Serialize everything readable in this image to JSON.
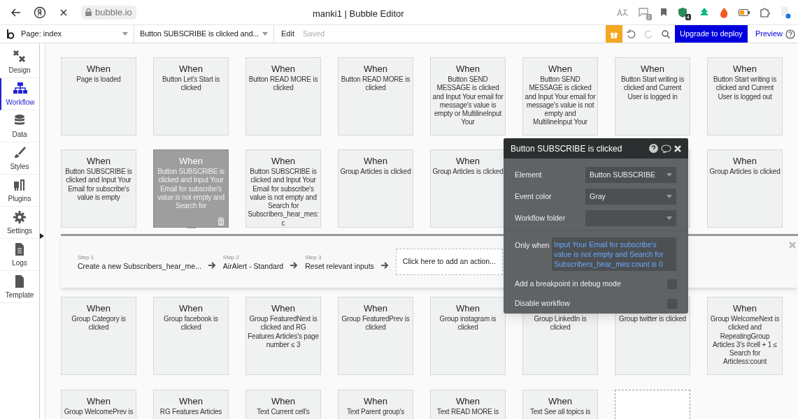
{
  "browser": {
    "url": "bubble.io",
    "title": "manki1 | Bubble Editor",
    "badges": [
      "2",
      "4"
    ]
  },
  "toolbar": {
    "page_selector": "Page: index",
    "workflow_selector": "Button SUBSCRIBE is clicked and...",
    "edit": "Edit",
    "save_status": "Saved",
    "upgrade": "Upgrade to deploy",
    "preview": "Preview"
  },
  "sidebar": {
    "items": [
      {
        "label": "Design",
        "selected": false,
        "kind": "design"
      },
      {
        "label": "Workflow",
        "selected": true,
        "kind": "workflow"
      },
      {
        "label": "Data",
        "selected": false,
        "kind": "data"
      },
      {
        "label": "Styles",
        "selected": false,
        "kind": "styles"
      },
      {
        "label": "Plugins",
        "selected": false,
        "kind": "plugins"
      },
      {
        "label": "Settings",
        "selected": false,
        "kind": "settings"
      },
      {
        "label": "Logs",
        "selected": false,
        "kind": "logs"
      },
      {
        "label": "Template",
        "selected": false,
        "kind": "template"
      }
    ]
  },
  "event_rows_above": [
    {
      "cards": [
        {
          "kind": "event",
          "heading": "When",
          "text": "Page is loaded",
          "selected": false
        },
        {
          "kind": "event",
          "heading": "When",
          "text": "Button Let's Start is clicked",
          "selected": false
        },
        {
          "kind": "event",
          "heading": "When",
          "text": "Button READ MORE is clicked",
          "selected": false
        },
        {
          "kind": "event",
          "heading": "When",
          "text": "Button READ MORE is clicked",
          "selected": false
        },
        {
          "kind": "event",
          "heading": "When",
          "text": "Button SEND MESSAGE is clicked and Input Your email for message's value is empty or MultilineInput Your",
          "selected": false
        },
        {
          "kind": "event",
          "heading": "When",
          "text": "Button SEND MESSAGE is clicked and Input Your email for message's value is not empty and MultilineInput Your",
          "selected": false
        },
        {
          "kind": "event",
          "heading": "When",
          "text": "Button Start writing is clicked and Current User is logged in",
          "selected": false
        },
        {
          "kind": "event",
          "heading": "When",
          "text": "Button Start writing is clicked and Current User is logged out",
          "selected": false
        }
      ]
    },
    {
      "cards": [
        {
          "kind": "event",
          "heading": "When",
          "text": "Button SUBSCRIBE is clicked and Input Your Email for subscribe's value is empty",
          "selected": false
        },
        {
          "kind": "event",
          "heading": "When",
          "text": "Button SUBSCRIBE is clicked and Input Your Email for subscribe's value is not empty and Search for",
          "selected": true
        },
        {
          "kind": "event",
          "heading": "When",
          "text": "Button SUBSCRIBE is clicked and Input Your Email for subscribe's value is not empty and Search for Subscribers_hear_mes:c",
          "selected": false
        },
        {
          "kind": "event",
          "heading": "When",
          "text": "Group Articles is clicked",
          "selected": false
        },
        {
          "kind": "event",
          "heading": "When",
          "text": "Group Articles is clicked",
          "selected": false
        },
        {
          "kind": "covered"
        },
        {
          "kind": "covered"
        },
        {
          "kind": "event",
          "heading": "When",
          "text": "Group Articles is clicked",
          "selected": false
        }
      ]
    }
  ],
  "action_panel": {
    "steps": [
      {
        "step": "Step 1",
        "action": "Create a new Subscribers_hear_me..."
      },
      {
        "step": "Step 2",
        "action": "AirAlert - Standard"
      },
      {
        "step": "Step 3",
        "action": "Reset relevant inputs"
      }
    ],
    "add_action": "Click here to add an action..."
  },
  "event_rows_below": [
    {
      "cards": [
        {
          "kind": "event",
          "heading": "When",
          "text": "Group Category is clicked",
          "selected": false
        },
        {
          "kind": "event",
          "heading": "When",
          "text": "Group facebook is clicked",
          "selected": false
        },
        {
          "kind": "event",
          "heading": "When",
          "text": "Group FeaturedNext is clicked and RG Features Articles's page number ≤ 3",
          "selected": false
        },
        {
          "kind": "event",
          "heading": "When",
          "text": "Group FeaturedPrev is clicked",
          "selected": false
        },
        {
          "kind": "event",
          "heading": "When",
          "text": "Group instagram is clicked",
          "selected": false
        },
        {
          "kind": "event",
          "text": "Group LinkedIn is clicked",
          "selected": false
        },
        {
          "kind": "event",
          "text": "Group twitter is clicked",
          "selected": false
        },
        {
          "kind": "event",
          "heading": "When",
          "text": "Group WelcomeNext is clicked and RepeatingGroup Articles 3's #cell + 1 ≤ Search for Articless:count",
          "selected": false
        }
      ]
    },
    {
      "cards": [
        {
          "kind": "event",
          "heading": "When",
          "text": "Group WelcomePrev is",
          "selected": false
        },
        {
          "kind": "event",
          "heading": "When",
          "text": "RG Features Articles",
          "selected": false
        },
        {
          "kind": "event",
          "heading": "When",
          "text": "Text Current cell's",
          "selected": false
        },
        {
          "kind": "event",
          "heading": "When",
          "text": "Text Parent group's",
          "selected": false
        },
        {
          "kind": "event",
          "heading": "When",
          "text": "Text READ MORE is",
          "selected": false
        },
        {
          "kind": "event",
          "heading": "When",
          "text": "Text See all topics is",
          "selected": false
        },
        {
          "kind": "new"
        }
      ]
    }
  ],
  "popup": {
    "title": "Button SUBSCRIBE is clicked",
    "fields": [
      {
        "label": "Element",
        "value": "Button SUBSCRIBE"
      },
      {
        "label": "Event color",
        "value": "Gray"
      },
      {
        "label": "Workflow folder"
      }
    ],
    "only_when": {
      "label": "Only when",
      "condition": "Input Your Email for subscribe's value is not empty and Search for Subscribers_hear_mes:count is 0"
    },
    "toggles": [
      {
        "label": "Add a breakpoint in debug mode",
        "checked": false
      },
      {
        "label": "Disable workflow",
        "checked": false
      }
    ]
  }
}
